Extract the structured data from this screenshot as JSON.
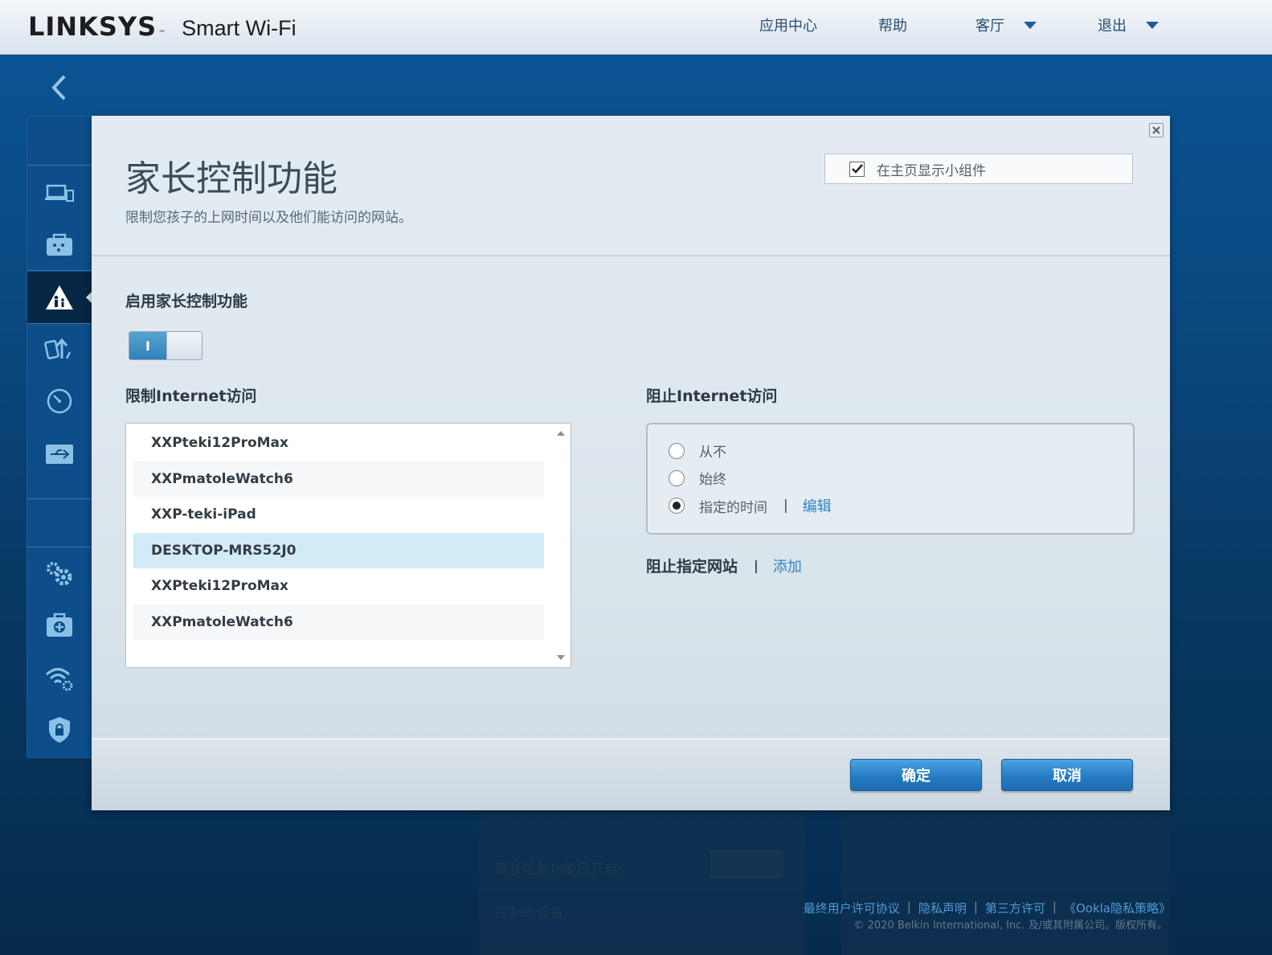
{
  "header": {
    "brand": "LINKSYS",
    "brand_tm": "™",
    "product": "Smart Wi-Fi",
    "nav": [
      "应用中心",
      "帮助",
      "客厅",
      "退出"
    ]
  },
  "modal": {
    "title": "家长控制功能",
    "subtitle": "限制您孩子的上网时间以及他们能访问的网站。",
    "show_widget_label": "在主页显示小组件",
    "show_widget_checked": true,
    "enable_label": "启用家长控制功能",
    "toggle_on_text": "I",
    "restrict_label": "限制Internet访问",
    "devices": [
      "XXPteki12ProMax",
      "XXPmatoleWatch6",
      "XXP-teki-iPad",
      "DESKTOP-MRS52J0",
      "XXPteki12ProMax",
      "XXPmatoleWatch6"
    ],
    "selected_device_index": 3,
    "block_label": "阻止Internet访问",
    "radio_never": "从不",
    "radio_always": "始终",
    "radio_scheduled": "指定的时间",
    "edit_link": "编辑",
    "block_sites_label": "阻止指定网站",
    "add_link": "添加",
    "separator": "|",
    "ok_button": "确定",
    "cancel_button": "取消"
  },
  "background": {
    "parental_status": "家长控制功能已开启:",
    "controlled_devices": "控制的设备:"
  },
  "footer": {
    "links": [
      "最终用户许可协议",
      "隐私声明",
      "第三方许可",
      "《Ookla隐私策略》"
    ],
    "copyright": "© 2020 Belkin International, Inc. 及/或其附属公司。版权所有。"
  },
  "colors": {
    "accent": "#2b85c4",
    "button": "#2379c0",
    "selected_row": "#d3ebf7"
  }
}
